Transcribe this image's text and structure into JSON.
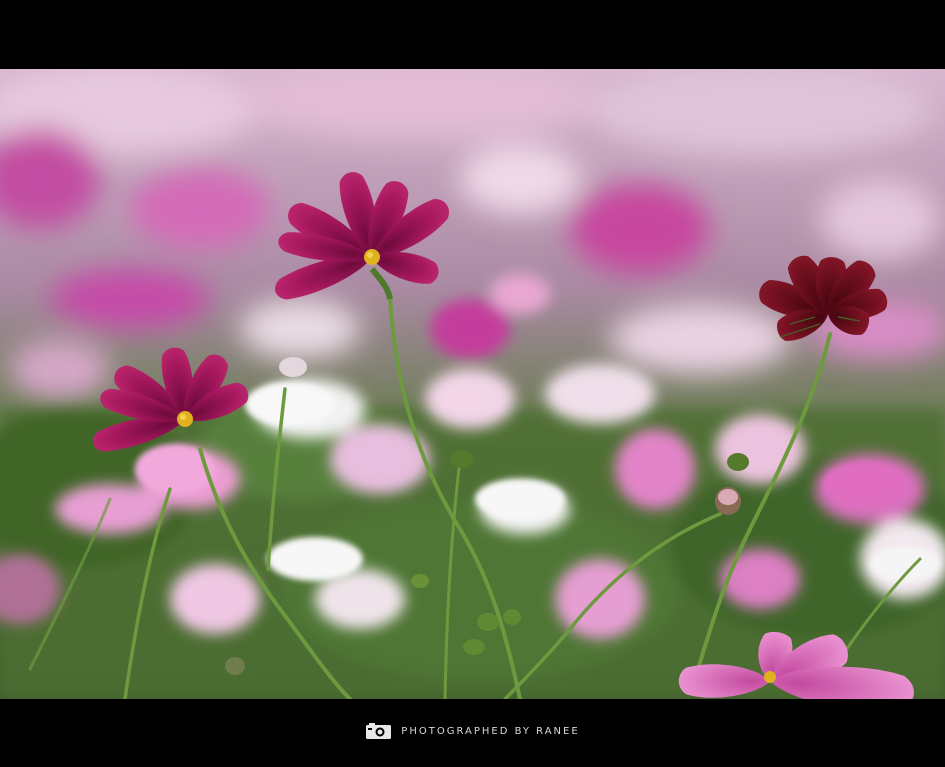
{
  "caption": {
    "text": "PHOTOGRAPHED BY RANEE",
    "icon": "camera-icon"
  },
  "colors": {
    "frame": "#000000",
    "foliage": "#4f6d3a",
    "magenta_flower": "#9c1456",
    "crimson_flower": "#6d0e1d",
    "pink_flower": "#e07fc2",
    "caption_text": "#d9d9d9"
  }
}
